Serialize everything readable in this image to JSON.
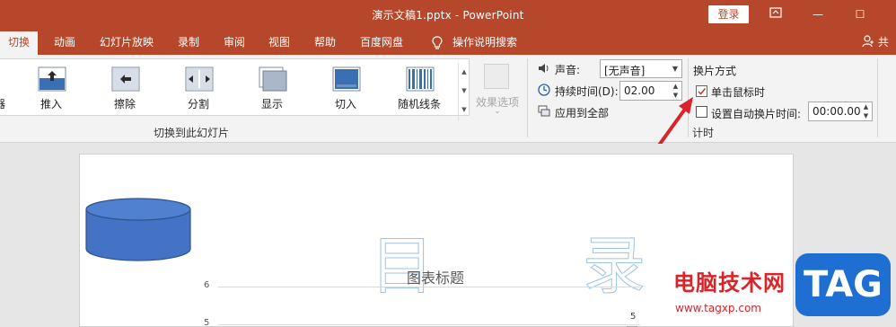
{
  "window": {
    "title": "演示文稿1.pptx  -  PowerPoint",
    "login_label": "登录",
    "controls": {
      "ribbon_icon": "ribbon-display-icon",
      "minimize": "—",
      "maximize": "☐"
    }
  },
  "tabs": [
    {
      "label": "切换",
      "active": true
    },
    {
      "label": "动画"
    },
    {
      "label": "幻灯片放映"
    },
    {
      "label": "录制"
    },
    {
      "label": "审阅"
    },
    {
      "label": "视图"
    },
    {
      "label": "帮助"
    },
    {
      "label": "百度网盘"
    },
    {
      "label": "操作说明搜索",
      "icon": "lightbulb-icon"
    }
  ],
  "share_label": "共享",
  "ribbon": {
    "gallery_items": [
      {
        "label": "推入",
        "icon": "push-icon"
      },
      {
        "label": "擦除",
        "icon": "wipe-icon"
      },
      {
        "label": "分割",
        "icon": "split-icon"
      },
      {
        "label": "显示",
        "icon": "reveal-icon"
      },
      {
        "label": "切入",
        "icon": "cut-icon"
      },
      {
        "label": "随机线条",
        "icon": "random-bars-icon"
      }
    ],
    "effect_options_label": "效果选项",
    "group_transition_label": "切换到此幻灯片",
    "sound_label": "声音:",
    "sound_value": "[无声音]",
    "duration_label": "持续时间(D):",
    "duration_value": "02.00",
    "apply_all_label": "应用到全部",
    "advance_header": "换片方式",
    "on_click_label": "单击鼠标时",
    "on_click_checked": true,
    "auto_after_label": "设置自动换片时间:",
    "auto_after_checked": false,
    "auto_after_value": "00:00.00",
    "group_timing_label": "计时"
  },
  "slide": {
    "decor_chars": [
      "目",
      "录"
    ],
    "chart_data": {
      "type": "bar",
      "title": "图表标题",
      "yticks": [
        "6",
        "5"
      ],
      "data_labels": [
        "5"
      ],
      "values": [
        5
      ],
      "ylim": [
        null,
        6
      ]
    }
  },
  "watermark": {
    "text": "电脑技术网",
    "url": "www.tagxp.com",
    "logo": "TAG"
  }
}
